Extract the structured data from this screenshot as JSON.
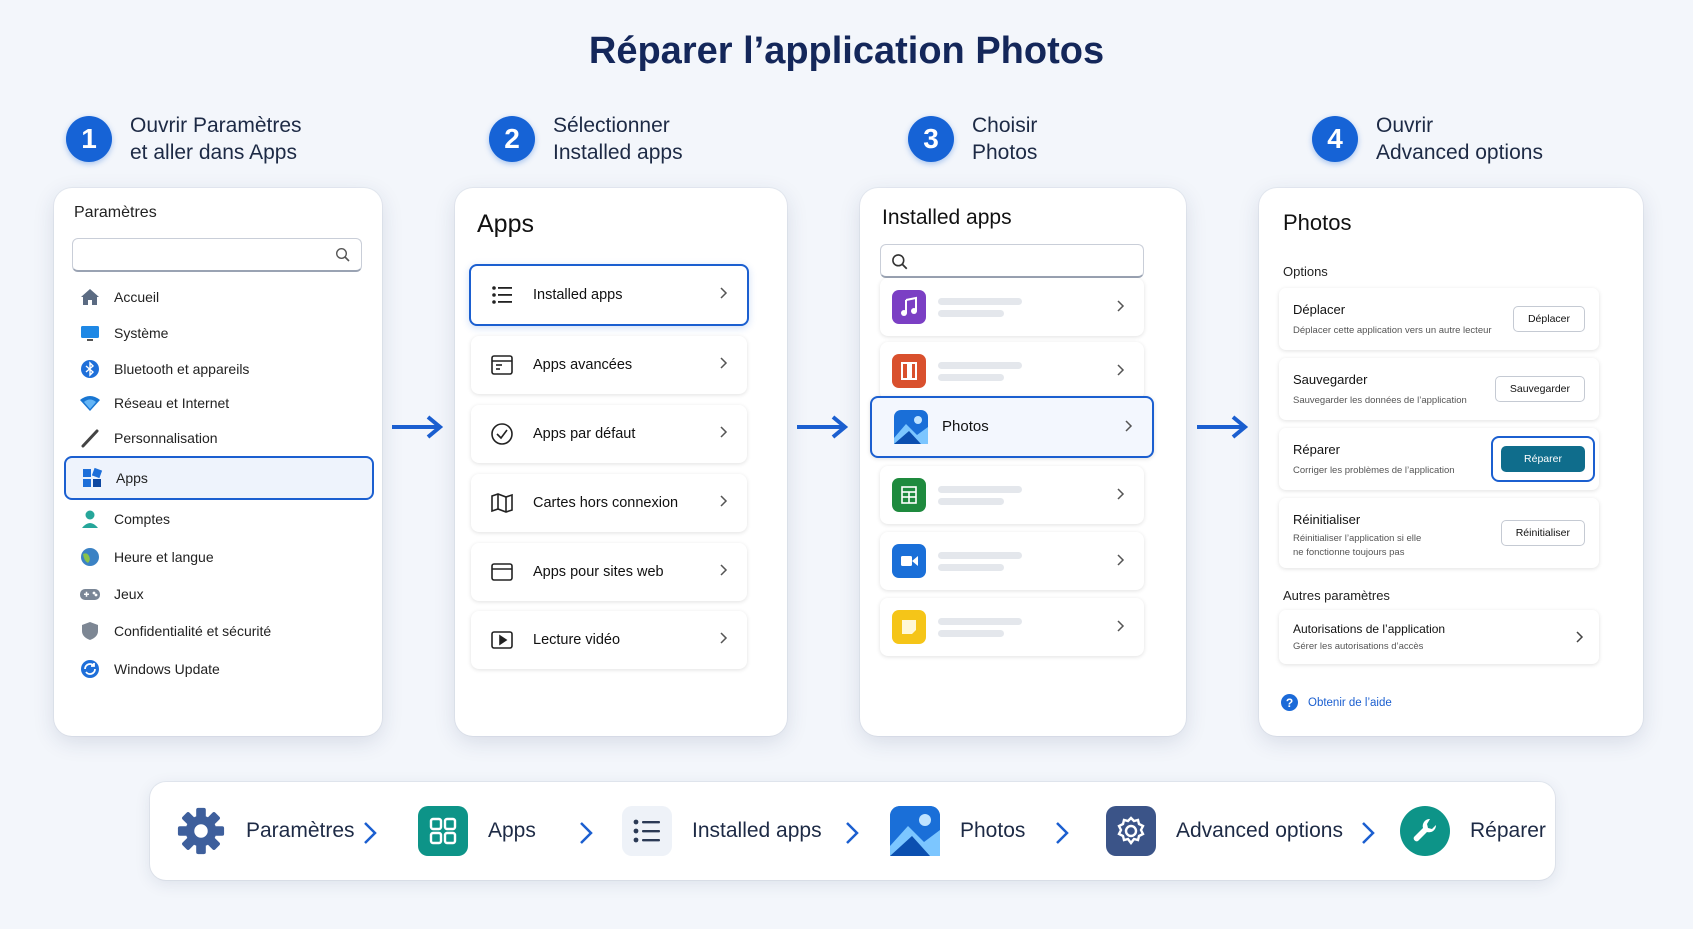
{
  "title": "Réparer l’application Photos",
  "steps": [
    {
      "num": "1",
      "text": "Ouvrir Paramètres\net aller dans Apps"
    },
    {
      "num": "2",
      "text": "Sélectionner\nInstalled apps"
    },
    {
      "num": "3",
      "text": "Choisir\nPhotos"
    },
    {
      "num": "4",
      "text": "Ouvrir\nAdvanced options"
    }
  ],
  "settings_panel": {
    "title": "Paramètres",
    "search_placeholder": "",
    "items": [
      {
        "label": "Accueil",
        "icon": "home-icon"
      },
      {
        "label": "Système",
        "icon": "monitor-icon"
      },
      {
        "label": "Bluetooth et appareils",
        "icon": "bluetooth-icon"
      },
      {
        "label": "Réseau et Internet",
        "icon": "wifi-icon"
      },
      {
        "label": "Personnalisation",
        "icon": "brush-icon"
      },
      {
        "label": "Apps",
        "icon": "apps-icon",
        "selected": true
      },
      {
        "label": "Comptes",
        "icon": "person-icon"
      },
      {
        "label": "Heure et langue",
        "icon": "globe-icon"
      },
      {
        "label": "Jeux",
        "icon": "gamepad-icon"
      },
      {
        "label": "Confidentialité et sécurité",
        "icon": "shield-icon"
      },
      {
        "label": "Windows Update",
        "icon": "update-icon"
      }
    ]
  },
  "apps_panel": {
    "title": "Apps",
    "items": [
      {
        "label": "Installed apps",
        "icon": "list-icon",
        "selected": true
      },
      {
        "label": "Apps avancées",
        "icon": "advanced-apps-icon"
      },
      {
        "label": "Apps par défaut",
        "icon": "check-circle-icon"
      },
      {
        "label": "Cartes hors connexion",
        "icon": "map-icon"
      },
      {
        "label": "Apps pour sites web",
        "icon": "browser-window-icon"
      },
      {
        "label": "Lecture vidéo",
        "icon": "video-play-icon"
      }
    ]
  },
  "installed_panel": {
    "title": "Installed apps",
    "search_placeholder": "",
    "apps": [
      {
        "name": "",
        "icon": "music-app-icon",
        "color": "#7b3fc4"
      },
      {
        "name": "",
        "icon": "office-app-icon",
        "color": "#d9502d"
      },
      {
        "name": "Photos",
        "icon": "photos-app-icon",
        "color": "#1a6fd8",
        "selected": true
      },
      {
        "name": "",
        "icon": "sheets-app-icon",
        "color": "#1e8a3e"
      },
      {
        "name": "",
        "icon": "video-app-icon",
        "color": "#1a6fd8"
      },
      {
        "name": "",
        "icon": "sticky-notes-app-icon",
        "color": "#f5c518"
      }
    ]
  },
  "photos_panel": {
    "title": "Photos",
    "options_label": "Options",
    "options": [
      {
        "title": "Déplacer",
        "desc": "Déplacer cette application vers un autre lecteur",
        "button": "Déplacer"
      },
      {
        "title": "Sauvegarder",
        "desc": "Sauvegarder les données de l’application",
        "button": "Sauvegarder"
      },
      {
        "title": "Réparer",
        "desc": "Corriger les problèmes de l’application",
        "button": "Réparer",
        "primary": true
      },
      {
        "title": "Réinitialiser",
        "desc": "Réinitialiser l’application si elle\nne fonctionne toujours pas",
        "button": "Réinitialiser"
      }
    ],
    "other_label": "Autres paramètres",
    "permissions": {
      "title": "Autorisations de l’application",
      "desc": "Gérer les autorisations d’accès"
    },
    "help": "Obtenir de l’aide"
  },
  "breadcrumb": [
    {
      "label": "Paramètres",
      "icon": "gear-icon"
    },
    {
      "label": "Apps",
      "icon": "apps-grid-icon"
    },
    {
      "label": "Installed apps",
      "icon": "list-icon"
    },
    {
      "label": "Photos",
      "icon": "photos-app-icon"
    },
    {
      "label": "Advanced options",
      "icon": "settings-cog-icon"
    },
    {
      "label": "Réparer",
      "icon": "wrench-icon"
    }
  ],
  "colors": {
    "accent": "#1b5fd0",
    "title": "#14275a",
    "repair_button": "#0f6d8c"
  }
}
